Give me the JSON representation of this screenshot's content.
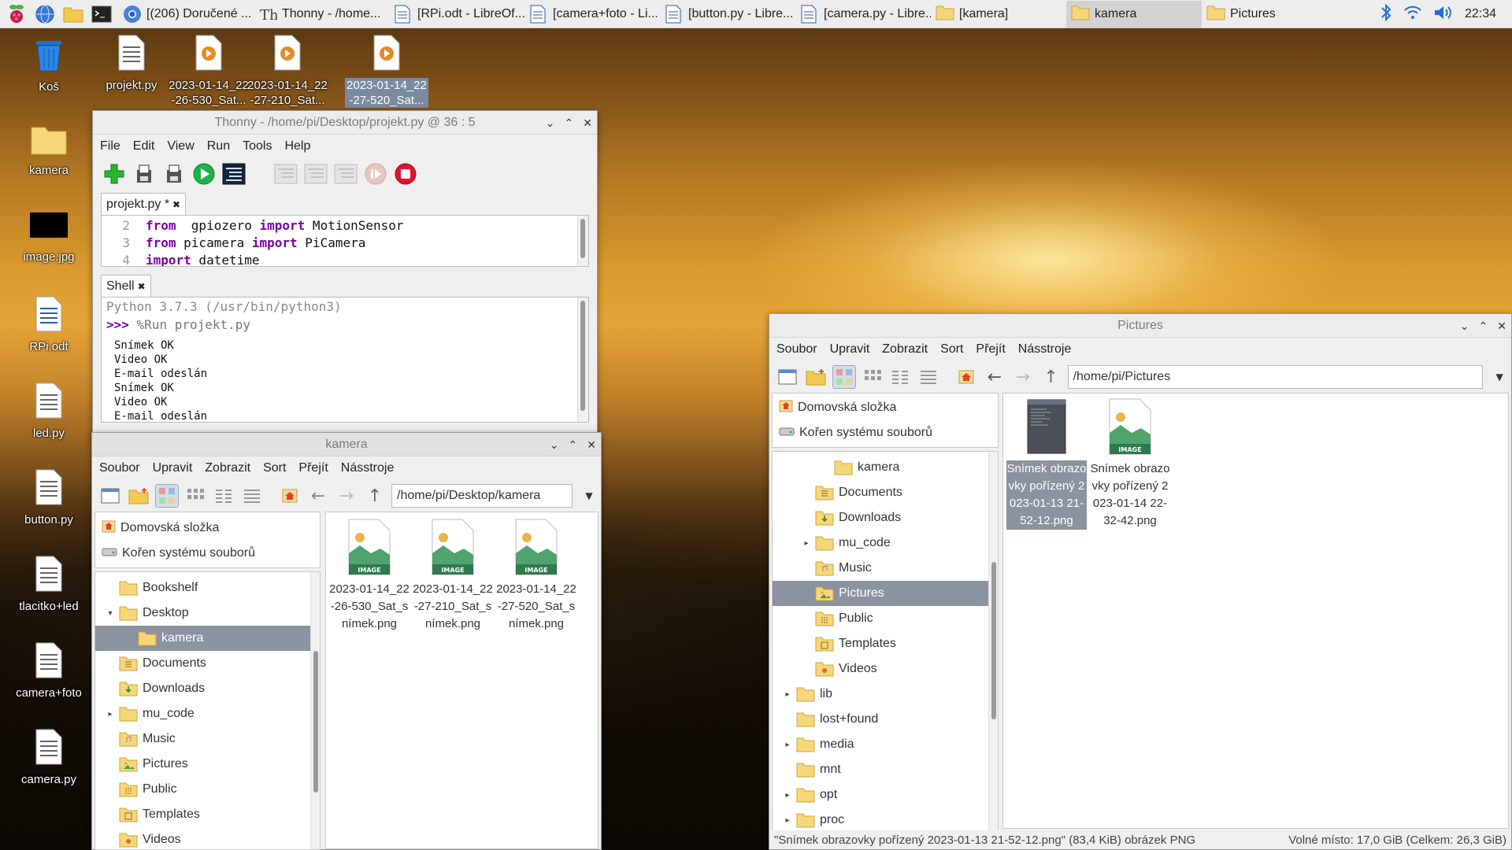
{
  "taskbar": {
    "windows": [
      {
        "label": "[(206) Doručené ...",
        "icon": "chromium-icon"
      },
      {
        "label": "Thonny  -  /home...",
        "icon": "thonny-icon"
      },
      {
        "label": "[RPi.odt - LibreOf...",
        "icon": "document-icon"
      },
      {
        "label": "[camera+foto - Li...",
        "icon": "document-icon"
      },
      {
        "label": "[button.py - Libre...",
        "icon": "document-icon"
      },
      {
        "label": "[camera.py - Libre...",
        "icon": "document-icon"
      },
      {
        "label": "[kamera]",
        "icon": "folder-icon"
      },
      {
        "label": "kamera",
        "icon": "folder-icon"
      },
      {
        "label": "Pictures",
        "icon": "folder-icon"
      }
    ],
    "clock": "22:34"
  },
  "desktop": {
    "left_icons": [
      {
        "label": "Koš",
        "icon": "trash-icon"
      },
      {
        "label": "kamera",
        "icon": "folder-icon"
      },
      {
        "label": "image.jpg",
        "icon": "image-icon"
      },
      {
        "label": "RPi.odt",
        "icon": "document-icon"
      },
      {
        "label": "led.py",
        "icon": "text-file-icon"
      },
      {
        "label": "button.py",
        "icon": "text-file-icon"
      },
      {
        "label": "tlacitko+led",
        "icon": "text-file-icon"
      },
      {
        "label": "camera+foto",
        "icon": "text-file-icon"
      },
      {
        "label": "camera.py",
        "icon": "text-file-icon"
      }
    ],
    "top_icons": [
      {
        "label": "projekt.py",
        "icon": "text-file-icon"
      },
      {
        "label": "2023-01-14_22-26-530_Sat...",
        "icon": "video-icon"
      },
      {
        "label": "2023-01-14_22-27-210_Sat...",
        "icon": "video-icon"
      },
      {
        "label": "2023-01-14_22-27-520_Sat...",
        "icon": "video-icon"
      }
    ]
  },
  "thonny": {
    "title": "Thonny  -  /home/pi/Desktop/projekt.py  @  36 : 5",
    "menu": [
      "File",
      "Edit",
      "View",
      "Run",
      "Tools",
      "Help"
    ],
    "editor_tab": "projekt.py *",
    "editor_lines": [
      {
        "num": "2",
        "parts": [
          [
            "kw",
            "from"
          ],
          [
            "",
            "  gpiozero "
          ],
          [
            "kw",
            "import"
          ],
          [
            "",
            " MotionSensor"
          ]
        ]
      },
      {
        "num": "3",
        "parts": [
          [
            "kw",
            "from"
          ],
          [
            "",
            " picamera "
          ],
          [
            "kw",
            "import"
          ],
          [
            "",
            " PiCamera"
          ]
        ]
      },
      {
        "num": "4",
        "parts": [
          [
            "kw",
            "import"
          ],
          [
            "",
            " datetime"
          ]
        ]
      }
    ],
    "shell_tab": "Shell",
    "shell_header": "Python 3.7.3 (/usr/bin/python3)",
    "shell_prompt": ">>>",
    "shell_command": "%Run projekt.py",
    "shell_output": [
      "Snímek OK",
      "Video OK",
      "E-mail odeslán",
      "Snímek OK",
      "Video OK",
      "E-mail odeslán"
    ]
  },
  "kamera": {
    "title": "kamera",
    "menu": [
      "Soubor",
      "Upravit",
      "Zobrazit",
      "Sort",
      "Přejít",
      "Násstroje"
    ],
    "address": "/home/pi/Desktop/kamera",
    "places": [
      "Domovská složka",
      "Kořen systému souborů"
    ],
    "tree": [
      {
        "label": "Bookshelf",
        "indent": 1,
        "exp": "",
        "sel": false
      },
      {
        "label": "Desktop",
        "indent": 1,
        "exp": "▾",
        "sel": false
      },
      {
        "label": "kamera",
        "indent": 2,
        "exp": "",
        "sel": true
      },
      {
        "label": "Documents",
        "indent": 1,
        "exp": "",
        "sel": false
      },
      {
        "label": "Downloads",
        "indent": 1,
        "exp": "",
        "sel": false
      },
      {
        "label": "mu_code",
        "indent": 1,
        "exp": "▸",
        "sel": false
      },
      {
        "label": "Music",
        "indent": 1,
        "exp": "",
        "sel": false
      },
      {
        "label": "Pictures",
        "indent": 1,
        "exp": "",
        "sel": false
      },
      {
        "label": "Public",
        "indent": 1,
        "exp": "",
        "sel": false
      },
      {
        "label": "Templates",
        "indent": 1,
        "exp": "",
        "sel": false
      },
      {
        "label": "Videos",
        "indent": 1,
        "exp": "",
        "sel": false
      }
    ],
    "files": [
      {
        "label": "2023-01-14_22-26-530_Sat_snímek.png"
      },
      {
        "label": "2023-01-14_22-27-210_Sat_snímek.png"
      },
      {
        "label": "2023-01-14_22-27-520_Sat_snímek.png"
      }
    ]
  },
  "pictures": {
    "title": "Pictures",
    "menu": [
      "Soubor",
      "Upravit",
      "Zobrazit",
      "Sort",
      "Přejít",
      "Násstroje"
    ],
    "address": "/home/pi/Pictures",
    "places": [
      "Domovská složka",
      "Kořen systému souborů"
    ],
    "tree": [
      {
        "label": "kamera",
        "indent": 3,
        "exp": "",
        "sel": false
      },
      {
        "label": "Documents",
        "indent": 2,
        "exp": "",
        "sel": false
      },
      {
        "label": "Downloads",
        "indent": 2,
        "exp": "",
        "sel": false
      },
      {
        "label": "mu_code",
        "indent": 2,
        "exp": "▸",
        "sel": false
      },
      {
        "label": "Music",
        "indent": 2,
        "exp": "",
        "sel": false
      },
      {
        "label": "Pictures",
        "indent": 2,
        "exp": "",
        "sel": true
      },
      {
        "label": "Public",
        "indent": 2,
        "exp": "",
        "sel": false
      },
      {
        "label": "Templates",
        "indent": 2,
        "exp": "",
        "sel": false
      },
      {
        "label": "Videos",
        "indent": 2,
        "exp": "",
        "sel": false
      },
      {
        "label": "lib",
        "indent": 1,
        "exp": "▸",
        "sel": false
      },
      {
        "label": "lost+found",
        "indent": 1,
        "exp": "",
        "sel": false
      },
      {
        "label": "media",
        "indent": 1,
        "exp": "▸",
        "sel": false
      },
      {
        "label": "mnt",
        "indent": 1,
        "exp": "",
        "sel": false
      },
      {
        "label": "opt",
        "indent": 1,
        "exp": "▸",
        "sel": false
      },
      {
        "label": "proc",
        "indent": 1,
        "exp": "▸",
        "sel": false
      }
    ],
    "files": [
      {
        "label": "Snímek obrazovky pořízený 2023-01-13 21-52-12.png",
        "sel": true,
        "kind": "screenshot"
      },
      {
        "label": "Snímek obrazovky pořízený 2023-01-14 22-32-42.png",
        "sel": false,
        "kind": "image"
      }
    ],
    "status_left": "\"Snímek obrazovky pořízený 2023-01-13 21-52-12.png\" (83,4 KiB) obrázek PNG",
    "status_right": "Volné místo: 17,0 GiB (Celkem: 26,3 GiB)"
  }
}
